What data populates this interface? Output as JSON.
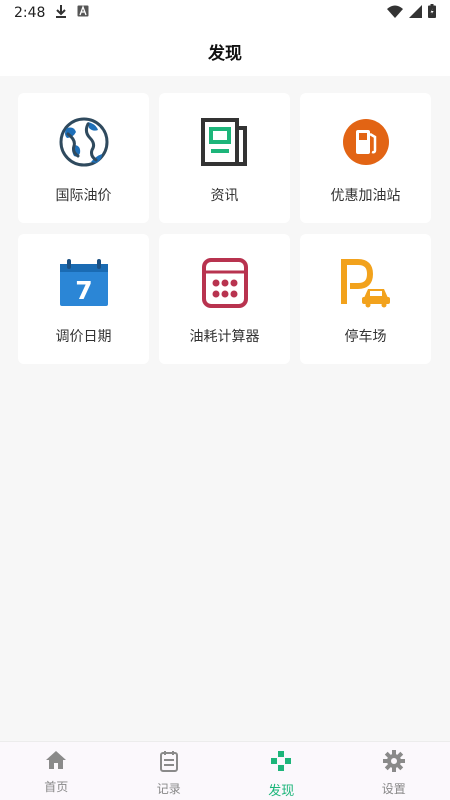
{
  "status_bar": {
    "time": "2:48",
    "icons": [
      "download-icon",
      "a-badge-icon",
      "wifi-icon",
      "signal-icon",
      "battery-icon"
    ]
  },
  "header": {
    "title": "发现"
  },
  "grid": {
    "items": [
      {
        "label": "国际油价",
        "icon": "globe-icon"
      },
      {
        "label": "资讯",
        "icon": "newspaper-icon"
      },
      {
        "label": "优惠加油站",
        "icon": "fuel-station-icon"
      },
      {
        "label": "调价日期",
        "icon": "calendar-icon"
      },
      {
        "label": "油耗计算器",
        "icon": "calculator-icon"
      },
      {
        "label": "停车场",
        "icon": "parking-icon"
      }
    ]
  },
  "tabbar": {
    "tabs": [
      {
        "label": "首页",
        "icon": "home-icon"
      },
      {
        "label": "记录",
        "icon": "record-icon"
      },
      {
        "label": "发现",
        "icon": "discover-icon",
        "active": true
      },
      {
        "label": "设置",
        "icon": "gear-icon"
      }
    ],
    "active_color": "#1db57a",
    "inactive_color": "#888888"
  }
}
